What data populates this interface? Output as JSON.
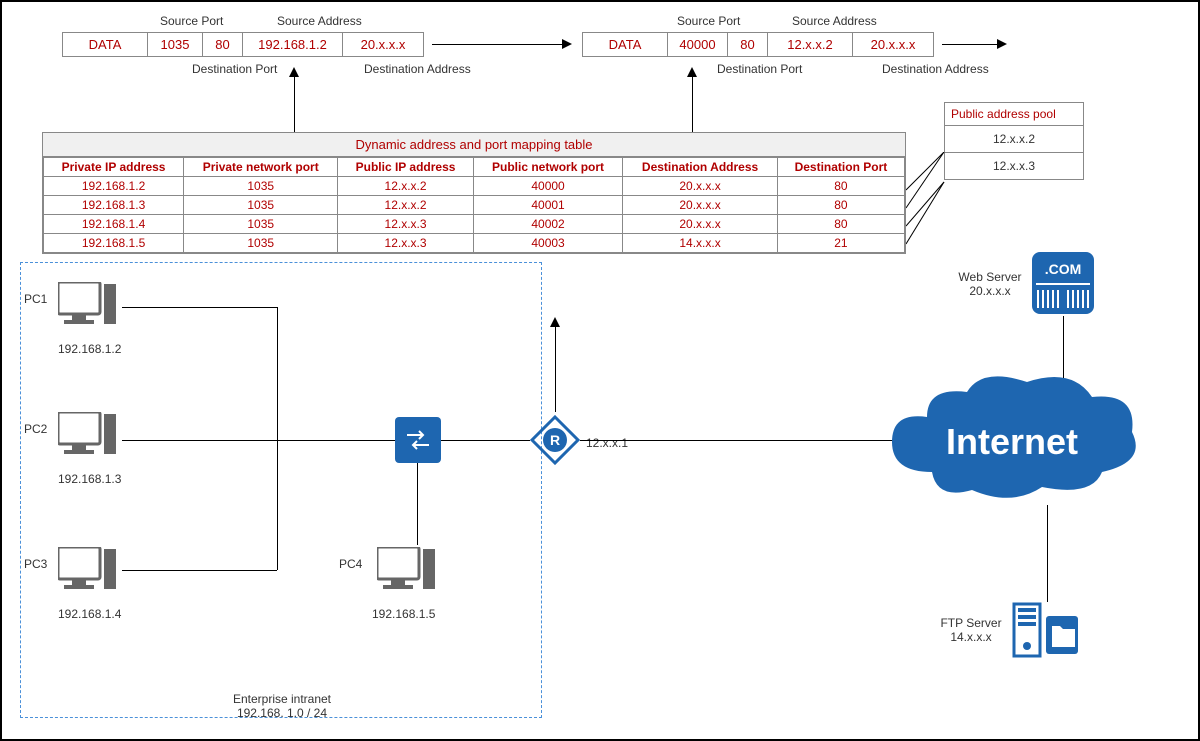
{
  "packet_before": {
    "labels": {
      "data": "DATA",
      "src_port": "1035",
      "dst_port": "80",
      "src_addr": "192.168.1.2",
      "dst_addr": "20.x.x.x"
    },
    "captions": {
      "src_port": "Source Port",
      "dst_port": "Destination Port",
      "src_addr": "Source Address",
      "dst_addr": "Destination Address"
    }
  },
  "packet_after": {
    "labels": {
      "data": "DATA",
      "src_port": "40000",
      "dst_port": "80",
      "src_addr": "12.x.x.2",
      "dst_addr": "20.x.x.x"
    },
    "captions": {
      "src_port": "Source Port",
      "dst_port": "Destination Port",
      "src_addr": "Source Address",
      "dst_addr": "Destination Address"
    }
  },
  "mapping_table": {
    "title": "Dynamic address and port mapping table",
    "headers": [
      "Private IP address",
      "Private network port",
      "Public IP address",
      "Public network port",
      "Destination Address",
      "Destination Port"
    ],
    "rows": [
      [
        "192.168.1.2",
        "1035",
        "12.x.x.2",
        "40000",
        "20.x.x.x",
        "80"
      ],
      [
        "192.168.1.3",
        "1035",
        "12.x.x.2",
        "40001",
        "20.x.x.x",
        "80"
      ],
      [
        "192.168.1.4",
        "1035",
        "12.x.x.3",
        "40002",
        "20.x.x.x",
        "80"
      ],
      [
        "192.168.1.5",
        "1035",
        "12.x.x.3",
        "40003",
        "14.x.x.x",
        "21"
      ]
    ]
  },
  "addr_pool": {
    "title": "Public address pool",
    "entries": [
      "12.x.x.2",
      "12.x.x.3"
    ]
  },
  "pcs": {
    "pc1": {
      "name": "PC1",
      "ip": "192.168.1.2"
    },
    "pc2": {
      "name": "PC2",
      "ip": "192.168.1.3"
    },
    "pc3": {
      "name": "PC3",
      "ip": "192.168.1.4"
    },
    "pc4": {
      "name": "PC4",
      "ip": "192.168.1.5"
    }
  },
  "intranet": {
    "caption_line1": "Enterprise intranet",
    "caption_line2": "192.168. 1.0 / 24"
  },
  "router": {
    "ip": "12.x.x.1"
  },
  "cloud": {
    "label": "Internet"
  },
  "web_server": {
    "name": "Web Server",
    "ip": "20.x.x.x",
    "badge": ".COM"
  },
  "ftp_server": {
    "name": "FTP Server",
    "ip": "14.x.x.x"
  },
  "chart_data": {
    "type": "table",
    "title": "Dynamic address and port mapping table",
    "columns": [
      "Private IP address",
      "Private network port",
      "Public IP address",
      "Public network port",
      "Destination Address",
      "Destination Port"
    ],
    "rows": [
      [
        "192.168.1.2",
        "1035",
        "12.x.x.2",
        "40000",
        "20.x.x.x",
        "80"
      ],
      [
        "192.168.1.3",
        "1035",
        "12.x.x.2",
        "40001",
        "20.x.x.x",
        "80"
      ],
      [
        "192.168.1.4",
        "1035",
        "12.x.x.3",
        "40002",
        "20.x.x.x",
        "80"
      ],
      [
        "192.168.1.5",
        "1035",
        "12.x.x.3",
        "40003",
        "14.x.x.x",
        "21"
      ]
    ],
    "public_address_pool": [
      "12.x.x.2",
      "12.x.x.3"
    ]
  }
}
